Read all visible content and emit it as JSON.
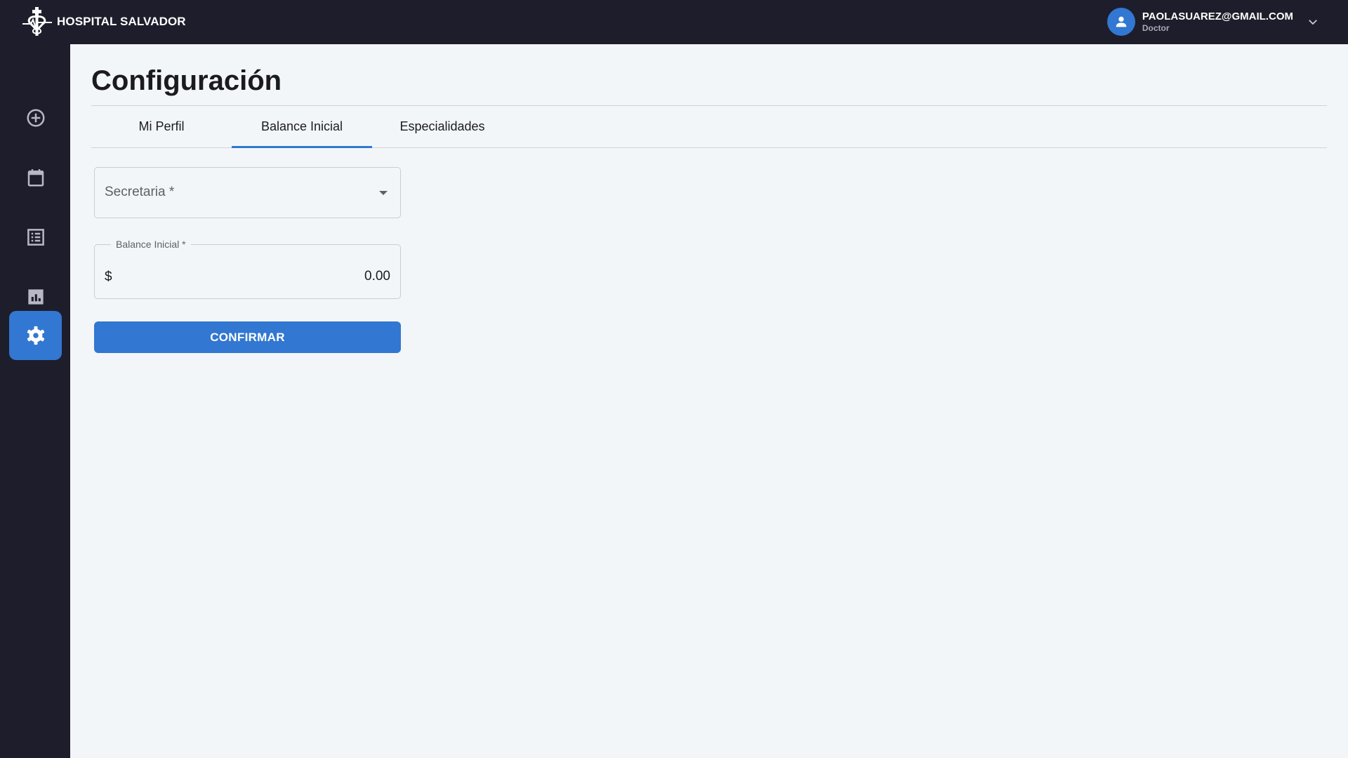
{
  "app": {
    "brand_name": "HOSPITAL SALVADOR",
    "brand_icon": "medical-cross-logo"
  },
  "user": {
    "email": "PAOLASUAREZ@GMAIL.COM",
    "role": "Doctor",
    "avatar_icon": "person-icon",
    "menu_icon": "chevron-down-icon"
  },
  "sidebar": {
    "items": [
      {
        "icon": "add-circle-icon",
        "active": false
      },
      {
        "icon": "calendar-icon",
        "active": false
      },
      {
        "icon": "list-icon",
        "active": false
      },
      {
        "icon": "bar-chart-icon",
        "active": false
      },
      {
        "icon": "gear-icon",
        "active": true
      }
    ]
  },
  "page": {
    "title": "Configuración",
    "tabs": [
      {
        "label": "Mi Perfil",
        "active": false
      },
      {
        "label": "Balance Inicial",
        "active": true
      },
      {
        "label": "Especialidades",
        "active": false
      }
    ]
  },
  "form": {
    "secretaria": {
      "label": "Secretaria *",
      "value": ""
    },
    "balance": {
      "label": "Balance Inicial *",
      "prefix": "$",
      "value": "0.00"
    },
    "confirm_label": "CONFIRMAR"
  },
  "colors": {
    "primary": "#3277d1",
    "nav_background": "#1e1d2b",
    "page_background": "#f3f6f9"
  }
}
